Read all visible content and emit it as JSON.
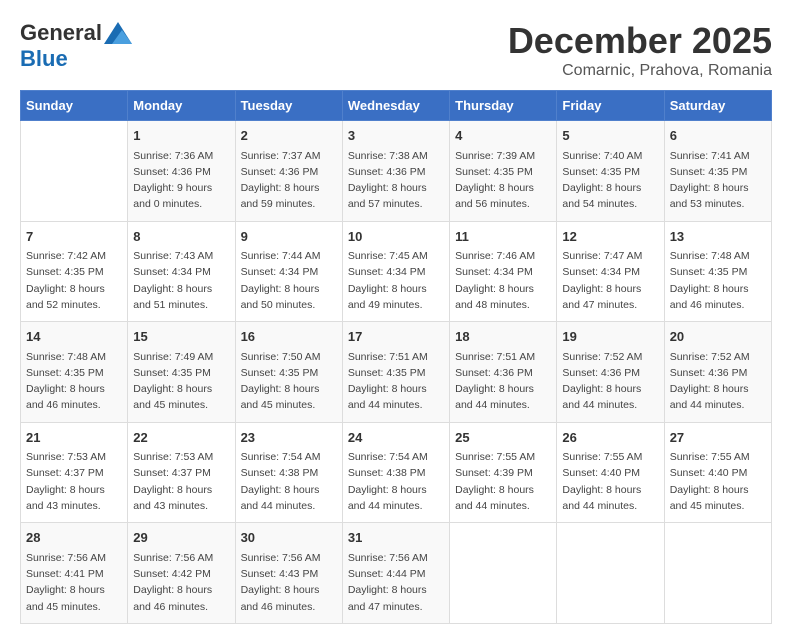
{
  "header": {
    "logo_general": "General",
    "logo_blue": "Blue",
    "month_title": "December 2025",
    "location": "Comarnic, Prahova, Romania"
  },
  "days_of_week": [
    "Sunday",
    "Monday",
    "Tuesday",
    "Wednesday",
    "Thursday",
    "Friday",
    "Saturday"
  ],
  "weeks": [
    [
      {
        "day": "",
        "info": ""
      },
      {
        "day": "1",
        "info": "Sunrise: 7:36 AM\nSunset: 4:36 PM\nDaylight: 9 hours\nand 0 minutes."
      },
      {
        "day": "2",
        "info": "Sunrise: 7:37 AM\nSunset: 4:36 PM\nDaylight: 8 hours\nand 59 minutes."
      },
      {
        "day": "3",
        "info": "Sunrise: 7:38 AM\nSunset: 4:36 PM\nDaylight: 8 hours\nand 57 minutes."
      },
      {
        "day": "4",
        "info": "Sunrise: 7:39 AM\nSunset: 4:35 PM\nDaylight: 8 hours\nand 56 minutes."
      },
      {
        "day": "5",
        "info": "Sunrise: 7:40 AM\nSunset: 4:35 PM\nDaylight: 8 hours\nand 54 minutes."
      },
      {
        "day": "6",
        "info": "Sunrise: 7:41 AM\nSunset: 4:35 PM\nDaylight: 8 hours\nand 53 minutes."
      }
    ],
    [
      {
        "day": "7",
        "info": "Sunrise: 7:42 AM\nSunset: 4:35 PM\nDaylight: 8 hours\nand 52 minutes."
      },
      {
        "day": "8",
        "info": "Sunrise: 7:43 AM\nSunset: 4:34 PM\nDaylight: 8 hours\nand 51 minutes."
      },
      {
        "day": "9",
        "info": "Sunrise: 7:44 AM\nSunset: 4:34 PM\nDaylight: 8 hours\nand 50 minutes."
      },
      {
        "day": "10",
        "info": "Sunrise: 7:45 AM\nSunset: 4:34 PM\nDaylight: 8 hours\nand 49 minutes."
      },
      {
        "day": "11",
        "info": "Sunrise: 7:46 AM\nSunset: 4:34 PM\nDaylight: 8 hours\nand 48 minutes."
      },
      {
        "day": "12",
        "info": "Sunrise: 7:47 AM\nSunset: 4:34 PM\nDaylight: 8 hours\nand 47 minutes."
      },
      {
        "day": "13",
        "info": "Sunrise: 7:48 AM\nSunset: 4:35 PM\nDaylight: 8 hours\nand 46 minutes."
      }
    ],
    [
      {
        "day": "14",
        "info": "Sunrise: 7:48 AM\nSunset: 4:35 PM\nDaylight: 8 hours\nand 46 minutes."
      },
      {
        "day": "15",
        "info": "Sunrise: 7:49 AM\nSunset: 4:35 PM\nDaylight: 8 hours\nand 45 minutes."
      },
      {
        "day": "16",
        "info": "Sunrise: 7:50 AM\nSunset: 4:35 PM\nDaylight: 8 hours\nand 45 minutes."
      },
      {
        "day": "17",
        "info": "Sunrise: 7:51 AM\nSunset: 4:35 PM\nDaylight: 8 hours\nand 44 minutes."
      },
      {
        "day": "18",
        "info": "Sunrise: 7:51 AM\nSunset: 4:36 PM\nDaylight: 8 hours\nand 44 minutes."
      },
      {
        "day": "19",
        "info": "Sunrise: 7:52 AM\nSunset: 4:36 PM\nDaylight: 8 hours\nand 44 minutes."
      },
      {
        "day": "20",
        "info": "Sunrise: 7:52 AM\nSunset: 4:36 PM\nDaylight: 8 hours\nand 44 minutes."
      }
    ],
    [
      {
        "day": "21",
        "info": "Sunrise: 7:53 AM\nSunset: 4:37 PM\nDaylight: 8 hours\nand 43 minutes."
      },
      {
        "day": "22",
        "info": "Sunrise: 7:53 AM\nSunset: 4:37 PM\nDaylight: 8 hours\nand 43 minutes."
      },
      {
        "day": "23",
        "info": "Sunrise: 7:54 AM\nSunset: 4:38 PM\nDaylight: 8 hours\nand 44 minutes."
      },
      {
        "day": "24",
        "info": "Sunrise: 7:54 AM\nSunset: 4:38 PM\nDaylight: 8 hours\nand 44 minutes."
      },
      {
        "day": "25",
        "info": "Sunrise: 7:55 AM\nSunset: 4:39 PM\nDaylight: 8 hours\nand 44 minutes."
      },
      {
        "day": "26",
        "info": "Sunrise: 7:55 AM\nSunset: 4:40 PM\nDaylight: 8 hours\nand 44 minutes."
      },
      {
        "day": "27",
        "info": "Sunrise: 7:55 AM\nSunset: 4:40 PM\nDaylight: 8 hours\nand 45 minutes."
      }
    ],
    [
      {
        "day": "28",
        "info": "Sunrise: 7:56 AM\nSunset: 4:41 PM\nDaylight: 8 hours\nand 45 minutes."
      },
      {
        "day": "29",
        "info": "Sunrise: 7:56 AM\nSunset: 4:42 PM\nDaylight: 8 hours\nand 46 minutes."
      },
      {
        "day": "30",
        "info": "Sunrise: 7:56 AM\nSunset: 4:43 PM\nDaylight: 8 hours\nand 46 minutes."
      },
      {
        "day": "31",
        "info": "Sunrise: 7:56 AM\nSunset: 4:44 PM\nDaylight: 8 hours\nand 47 minutes."
      },
      {
        "day": "",
        "info": ""
      },
      {
        "day": "",
        "info": ""
      },
      {
        "day": "",
        "info": ""
      }
    ]
  ]
}
